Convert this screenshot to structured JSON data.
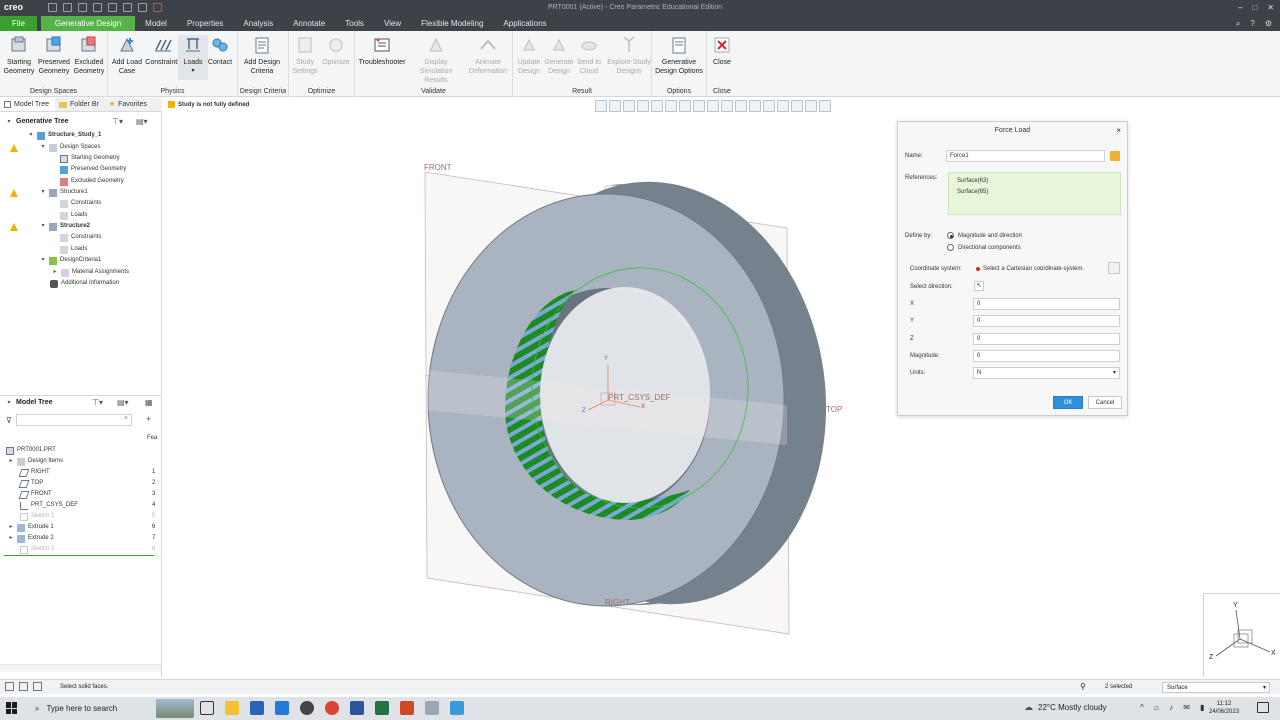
{
  "app": {
    "logo": "creo",
    "title": "PRT0001 (Active) - Creo Parametric Educational Edition"
  },
  "menu": {
    "tabs": [
      "File",
      "Generative Design",
      "Model",
      "Properties",
      "Analysis",
      "Annotate",
      "Tools",
      "View",
      "Flexible Modeling",
      "Applications"
    ],
    "active": "Generative Design"
  },
  "ribbon": {
    "groups": [
      {
        "label": "Design Spaces",
        "buttons": [
          "Starting Geometry",
          "Preserved Geometry",
          "Excluded Geometry"
        ]
      },
      {
        "label": "Physics",
        "buttons": [
          "Add Load Case",
          "Constraints",
          "Loads",
          "Contact"
        ]
      },
      {
        "label": "Design Criteria",
        "buttons": [
          "Add Design Criteria"
        ]
      },
      {
        "label": "Optimize",
        "buttons": [
          "Study Settings",
          "Optimize"
        ]
      },
      {
        "label": "Validate",
        "buttons": [
          "Troubleshooter",
          "Display Simulation Results",
          "Animate Deformation"
        ]
      },
      {
        "label": "Result",
        "buttons": [
          "Update Design",
          "Generate Design",
          "Send to Cloud",
          "Explore Study Designs"
        ]
      },
      {
        "label": "Options",
        "buttons": [
          "Generative Design Options"
        ]
      },
      {
        "label": "Close",
        "buttons": [
          "Close"
        ]
      }
    ]
  },
  "navtabs": [
    "Model Tree",
    "Folder Br",
    "Favorites"
  ],
  "gentree": {
    "title": "Generative Tree",
    "items": [
      "Structure_Study_1",
      "Design Spaces",
      "Starting Geometry",
      "Preserved Geometry",
      "Excluded Geometry",
      "Structure1",
      "Constraints",
      "Loads",
      "Structure2",
      "Constraints",
      "Loads",
      "DesignCriteria1",
      "Material Assignments",
      "Additional Information"
    ]
  },
  "modeltree": {
    "title": "Model Tree",
    "col": "Fea",
    "items": [
      {
        "name": "PRT0001.PRT",
        "num": ""
      },
      {
        "name": "Design Items",
        "num": ""
      },
      {
        "name": "RIGHT",
        "num": "1"
      },
      {
        "name": "TOP",
        "num": "2"
      },
      {
        "name": "FRONT",
        "num": "3"
      },
      {
        "name": "PRT_CSYS_DEF",
        "num": "4"
      },
      {
        "name": "Sketch 1",
        "num": "5"
      },
      {
        "name": "Extrude 1",
        "num": "6"
      },
      {
        "name": "Extrude 2",
        "num": "7"
      },
      {
        "name": "Sketch 2",
        "num": "8"
      }
    ]
  },
  "viewport": {
    "status": "Study is not fully defined",
    "labels": {
      "front": "FRONT",
      "top": "TOP",
      "right": "RIGHT",
      "csys": "PRT_CSYS_DEF"
    },
    "axes": {
      "x": "X",
      "y": "Y",
      "z": "Z"
    }
  },
  "dialog": {
    "title": "Force Load",
    "name_label": "Name:",
    "name_value": "Force1",
    "references_label": "References:",
    "references": [
      "Surface(63)",
      "Surface(65)"
    ],
    "define_by_label": "Define by:",
    "define_options": [
      "Magnitude and direction",
      "Directional components"
    ],
    "coord_label": "Coordinate system:",
    "coord_value": "Select a Cartesian coordinate system.",
    "direction_label": "Select direction:",
    "x_label": "X",
    "x_value": "0",
    "y_label": "Y",
    "y_value": "0",
    "z_label": "Z",
    "z_value": "0",
    "magnitude_label": "Magnitude:",
    "magnitude_value": "0",
    "units_label": "Units:",
    "units_value": "N",
    "ok": "OK",
    "cancel": "Cancel"
  },
  "statusbar": {
    "message": "Select solid faces.",
    "selected": "2 selected",
    "filter": "Surface"
  },
  "taskbar": {
    "search": "Type here to search",
    "weather": "22°C  Mostly cloudy",
    "time": "11:12",
    "date": "24/06/2023"
  }
}
